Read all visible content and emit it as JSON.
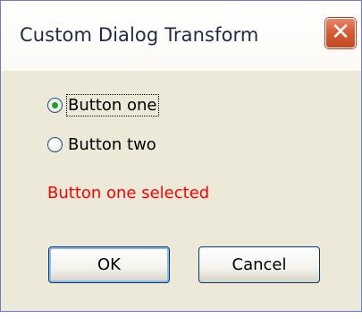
{
  "window": {
    "title": "Custom Dialog Transform",
    "close_glyph": "✕"
  },
  "options": [
    {
      "label": "Button one",
      "checked": true
    },
    {
      "label": "Button two",
      "checked": false
    }
  ],
  "status_text": "Button one selected",
  "buttons": {
    "ok_label": "OK",
    "cancel_label": "Cancel"
  },
  "colors": {
    "status": "#ff0000",
    "close_button": "#d85c36",
    "radio_dot": "#21a121"
  }
}
